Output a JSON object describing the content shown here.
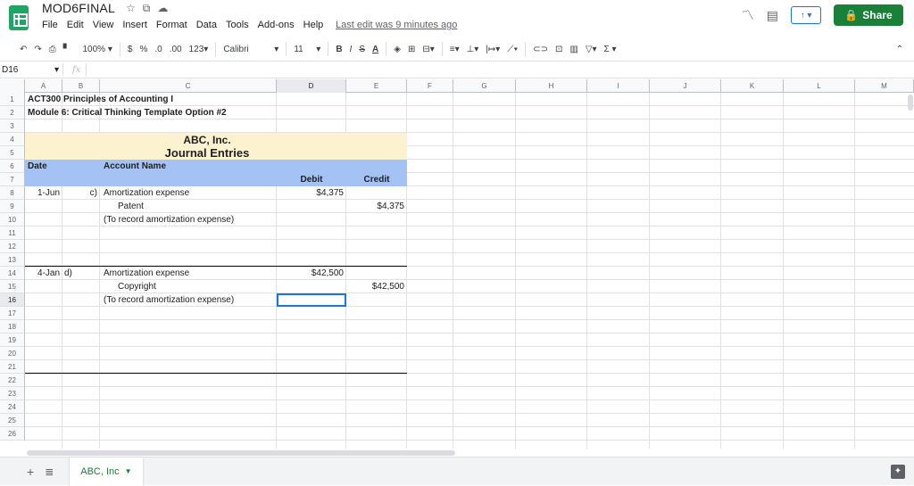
{
  "app": {
    "doc_title": "MOD6FINAL",
    "last_edit": "Last edit was 9 minutes ago",
    "share_label": "Share",
    "menu": [
      "File",
      "Edit",
      "View",
      "Insert",
      "Format",
      "Data",
      "Tools",
      "Add-ons",
      "Help"
    ]
  },
  "toolbar": {
    "zoom": "100%",
    "currency": "$",
    "percent": "%",
    "dec_decrease": ".0",
    "dec_increase": ".00",
    "more_formats": "123",
    "font": "Calibri",
    "font_size": "11",
    "bold": "B",
    "italic": "I",
    "strike": "S",
    "text_color": "A",
    "sum": "Σ"
  },
  "formula": {
    "cell_ref": "D16",
    "fx": "fx",
    "value": ""
  },
  "columns": [
    {
      "label": "A",
      "w": 42
    },
    {
      "label": "B",
      "w": 42
    },
    {
      "label": "C",
      "w": 198
    },
    {
      "label": "D",
      "w": 78
    },
    {
      "label": "E",
      "w": 68
    },
    {
      "label": "F",
      "w": 52
    },
    {
      "label": "G",
      "w": 70
    },
    {
      "label": "H",
      "w": 80
    },
    {
      "label": "I",
      "w": 70
    },
    {
      "label": "J",
      "w": 80
    },
    {
      "label": "K",
      "w": 70
    },
    {
      "label": "L",
      "w": 80
    },
    {
      "label": "M",
      "w": 66
    }
  ],
  "rows": [
    "1",
    "2",
    "3",
    "4",
    "5",
    "6",
    "7",
    "8",
    "9",
    "10",
    "11",
    "12",
    "13",
    "14",
    "15",
    "16",
    "17",
    "18",
    "19",
    "20",
    "21",
    "22",
    "23",
    "24",
    "25",
    "26"
  ],
  "sheet": {
    "r1": "ACT300 Principles of Accounting I",
    "r2": "Module 6: Critical Thinking Template Option #2",
    "company": "ABC, Inc.",
    "heading": "Journal Entries",
    "date_header": "Date",
    "account_header": "Account Name",
    "debit_header": "Debit",
    "credit_header": "Credit",
    "e1": {
      "date": "1-Jun",
      "letter": "c)",
      "debit_account": "Amortization expense",
      "credit_account": "Patent",
      "memo": "(To record amortization expense)",
      "debit": "$4,375",
      "credit": "$4,375"
    },
    "e2": {
      "date": "4-Jan",
      "letter": "d)",
      "debit_account": "Amortization expense",
      "credit_account": "Copyright",
      "memo": "(To record amortization expense)",
      "debit": "$42,500",
      "credit": "$42,500"
    }
  },
  "tabs": {
    "active": "ABC, Inc"
  },
  "colors": {
    "brand_green": "#188038",
    "header_fill": "#fdf2d0",
    "column_header_fill": "#a4c2f4",
    "selection": "#1a73e8"
  }
}
